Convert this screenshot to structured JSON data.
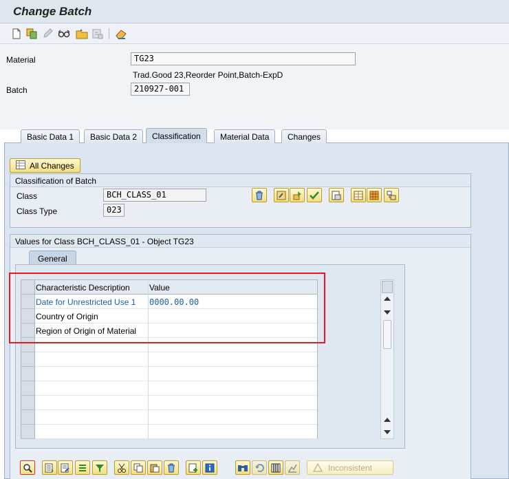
{
  "window": {
    "title": "Change Batch"
  },
  "toolbar": {
    "icons": [
      "new-document-icon",
      "copy-icon",
      "pencil-icon",
      "glasses-icon",
      "folder-icon",
      "settings-icon",
      "eraser-icon"
    ]
  },
  "header": {
    "material_label": "Material",
    "material_value": "TG23",
    "material_desc": "Trad.Good 23,Reorder Point,Batch-ExpD",
    "batch_label": "Batch",
    "batch_value": "210927-001"
  },
  "tabs": [
    {
      "label": "Basic Data 1"
    },
    {
      "label": "Basic Data 2"
    },
    {
      "label": "Classification"
    },
    {
      "label": "Material Data"
    },
    {
      "label": "Changes"
    }
  ],
  "classification": {
    "all_changes_label": "All Changes",
    "group_title": "Classification of Batch",
    "class_label": "Class",
    "class_value": "BCH_CLASS_01",
    "class_type_label": "Class Type",
    "class_type_value": "023"
  },
  "values": {
    "group_title": "Values for Class BCH_CLASS_01 - Object TG23",
    "subtab_label": "General",
    "columns": [
      "Characteristic Description",
      "Value"
    ],
    "rows": [
      {
        "desc": "Date for Unrestricted Use 1",
        "value": "0000.00.00"
      },
      {
        "desc": "Country of Origin",
        "value": ""
      },
      {
        "desc": "Region of Origin of Material",
        "value": ""
      },
      {
        "desc": "",
        "value": ""
      },
      {
        "desc": "",
        "value": ""
      },
      {
        "desc": "",
        "value": ""
      },
      {
        "desc": "",
        "value": ""
      },
      {
        "desc": "",
        "value": ""
      },
      {
        "desc": "",
        "value": ""
      },
      {
        "desc": "",
        "value": ""
      }
    ]
  },
  "bottom_toolbar": {
    "inconsistent_label": "Inconsistent"
  },
  "colors": {
    "highlight_border": "#e8191e",
    "link_text": "#1a5fa8"
  }
}
